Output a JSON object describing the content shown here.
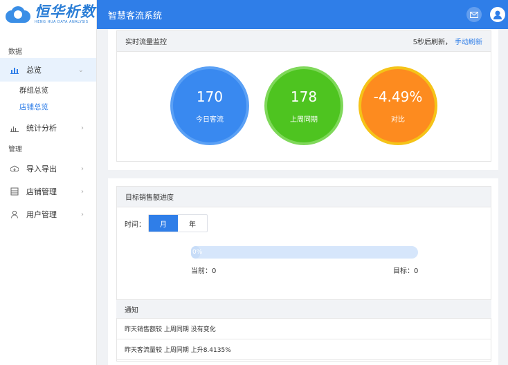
{
  "logo": {
    "main": "恒华析数",
    "sub": "HENG HUA DATA ANALYSIS"
  },
  "header": {
    "title": "智慧客流系统"
  },
  "sidebar": {
    "group_data": "数据",
    "group_manage": "管理",
    "items": [
      {
        "label": "总览",
        "icon": "bar-chart-icon"
      },
      {
        "label": "统计分析",
        "icon": "stats-icon"
      },
      {
        "label": "导入导出",
        "icon": "cloud-icon"
      },
      {
        "label": "店铺管理",
        "icon": "store-icon"
      },
      {
        "label": "用户管理",
        "icon": "user-icon"
      }
    ],
    "sub_items": [
      {
        "label": "群组总览"
      },
      {
        "label": "店铺总览"
      }
    ]
  },
  "monitor": {
    "title": "实时流量监控",
    "refresh_text": "5秒后刷新，",
    "refresh_link": "手动刷新",
    "circles": [
      {
        "value": "170",
        "label": "今日客流",
        "color": "#3989f0"
      },
      {
        "value": "178",
        "label": "上周同期",
        "color": "#4ec420"
      },
      {
        "value": "-4.49%",
        "label": "对比",
        "color": "#fd8b1f"
      }
    ]
  },
  "sales": {
    "title": "目标销售额进度",
    "time_label": "时间：",
    "tabs": [
      "月",
      "年"
    ],
    "progress_text": "0%",
    "progress_value": 0,
    "current": "当前：0",
    "target": "目标：0"
  },
  "notice": {
    "title": "通知",
    "rows": [
      "昨天销售额较 上周同期 没有变化",
      "昨天客流量较 上周同期 上升8.4135%"
    ]
  }
}
